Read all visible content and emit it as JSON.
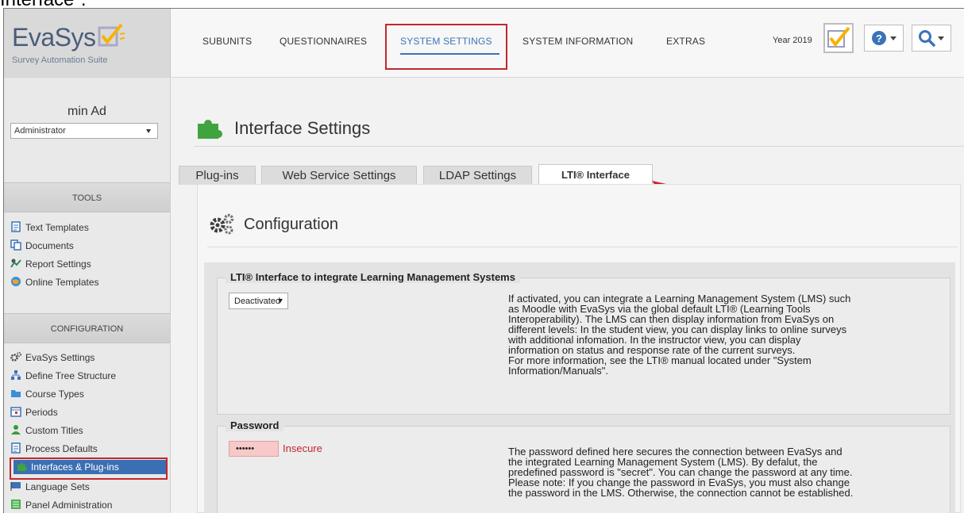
{
  "caption": "Interface\".",
  "logo": {
    "name": "EvaSys",
    "subtitle": "Survey Automation Suite"
  },
  "nav": [
    "SUBUNITS",
    "QUESTIONNAIRES",
    "SYSTEM SETTINGS",
    "SYSTEM INFORMATION",
    "EXTRAS"
  ],
  "nav_active": "SYSTEM SETTINGS",
  "year_label": "Year 2019",
  "user": {
    "name": "min Ad",
    "role": "Administrator"
  },
  "sidebar": {
    "tools_head": "TOOLS",
    "tools": [
      "Text Templates",
      "Documents",
      "Report Settings",
      "Online Templates"
    ],
    "config_head": "CONFIGURATION",
    "config": [
      "EvaSys Settings",
      "Define Tree Structure",
      "Course Types",
      "Periods",
      "Custom Titles",
      "Process Defaults",
      "Interfaces & Plug-ins",
      "Language Sets",
      "Panel Administration"
    ],
    "selected": "Interfaces & Plug-ins"
  },
  "page_title": "Interface Settings",
  "tabs": [
    "Plug-ins",
    "Web Service Settings",
    "LDAP Settings",
    "LTI® Interface"
  ],
  "tab_active": "LTI® Interface",
  "section_title": "Configuration",
  "lti": {
    "legend": "LTI® Interface to integrate Learning Management Systems",
    "select_value": "Deactivated",
    "description": [
      "If activated, you can integrate a Learning Management System (LMS) such",
      "as Moodle with EvaSys via the global default LTI® (Learning Tools",
      "Interoperability). The LMS can then display information from EvaSys on",
      "different levels: In the student view, you can display links to online surveys",
      "with additional infomation. In the instructor view, you can display",
      "information on status and response rate of the current surveys.",
      "For more information, see the LTI® manual located under \"System",
      "Information/Manuals\"."
    ]
  },
  "password": {
    "legend": "Password",
    "value": "••••••",
    "status": "Insecure",
    "description": [
      "The password defined here secures the connection between EvaSys and",
      "the integrated Learning Management System (LMS). By defalut, the",
      "predefined password is \"secret\". You can change the password at any time.",
      "Please note: If you change the password in EvaSys, you must also change",
      "the password in the LMS. Otherwise, the connection cannot be established."
    ]
  },
  "colors": {
    "accent": "#3a73b8",
    "highlight_box": "#c0282d",
    "selected_item": "#3b6fb4",
    "logo_check": "#f5b400"
  },
  "icons": {
    "title": "puzzle-icon",
    "config": "gears-icon",
    "help": "question-circle-icon",
    "search": "search-icon",
    "tools": [
      "document-icon",
      "documents-icon",
      "report-settings-icon",
      "globe-icon"
    ],
    "config_items": [
      "gears-icon",
      "tree-icon",
      "folder-icon",
      "calendar-icon",
      "user-icon",
      "document-icon",
      "puzzle-icon",
      "flag-icon",
      "panel-icon"
    ]
  }
}
